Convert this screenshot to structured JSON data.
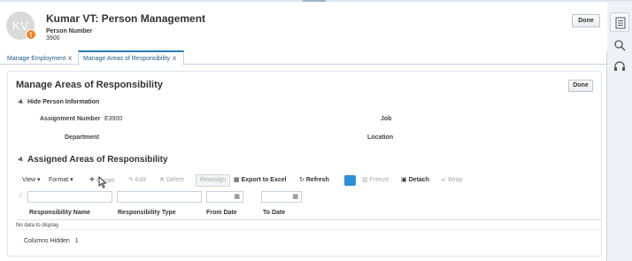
{
  "header": {
    "avatar_initials": "KV",
    "avatar_badge": "!",
    "title": "Kumar VT: Person Management",
    "person_number_label": "Person Number",
    "person_number": "3900",
    "done_label": "Done"
  },
  "tabs": [
    {
      "label": "Manage Employment",
      "close": "x",
      "active": false
    },
    {
      "label": "Manage Areas of Responsibility",
      "close": "x",
      "active": true
    }
  ],
  "panel": {
    "title": "Manage Areas of Responsibility",
    "done_label": "Done",
    "hide_info_label": "Hide Person Information",
    "fields": {
      "assignment_number_label": "Assignment Number",
      "assignment_number_value": "E3900",
      "department_label": "Department",
      "job_label": "Job",
      "location_label": "Location"
    },
    "assigned_title": "Assigned Areas of Responsibility"
  },
  "toolbar": {
    "view": "View",
    "format": "Format",
    "create": "Create",
    "edit": "Edit",
    "delete": "Delete",
    "reassign": "Reassign",
    "export": "Export to Excel",
    "refresh": "Refresh",
    "freeze": "Freeze",
    "detach": "Detach",
    "wrap": "Wrap"
  },
  "table": {
    "columns": [
      "Responsibility Name",
      "Responsibility Type",
      "From Date",
      "To Date"
    ],
    "no_data": "No data to display.",
    "columns_hidden_label": "Columns Hidden",
    "columns_hidden_count": "1"
  },
  "colors": {
    "accent": "#2a7ab5",
    "badge": "#e8852a",
    "link": "#1f5b88"
  },
  "icons": [
    "help-list-icon",
    "search-icon",
    "headset-icon",
    "calendar-icon",
    "filter-icon"
  ]
}
